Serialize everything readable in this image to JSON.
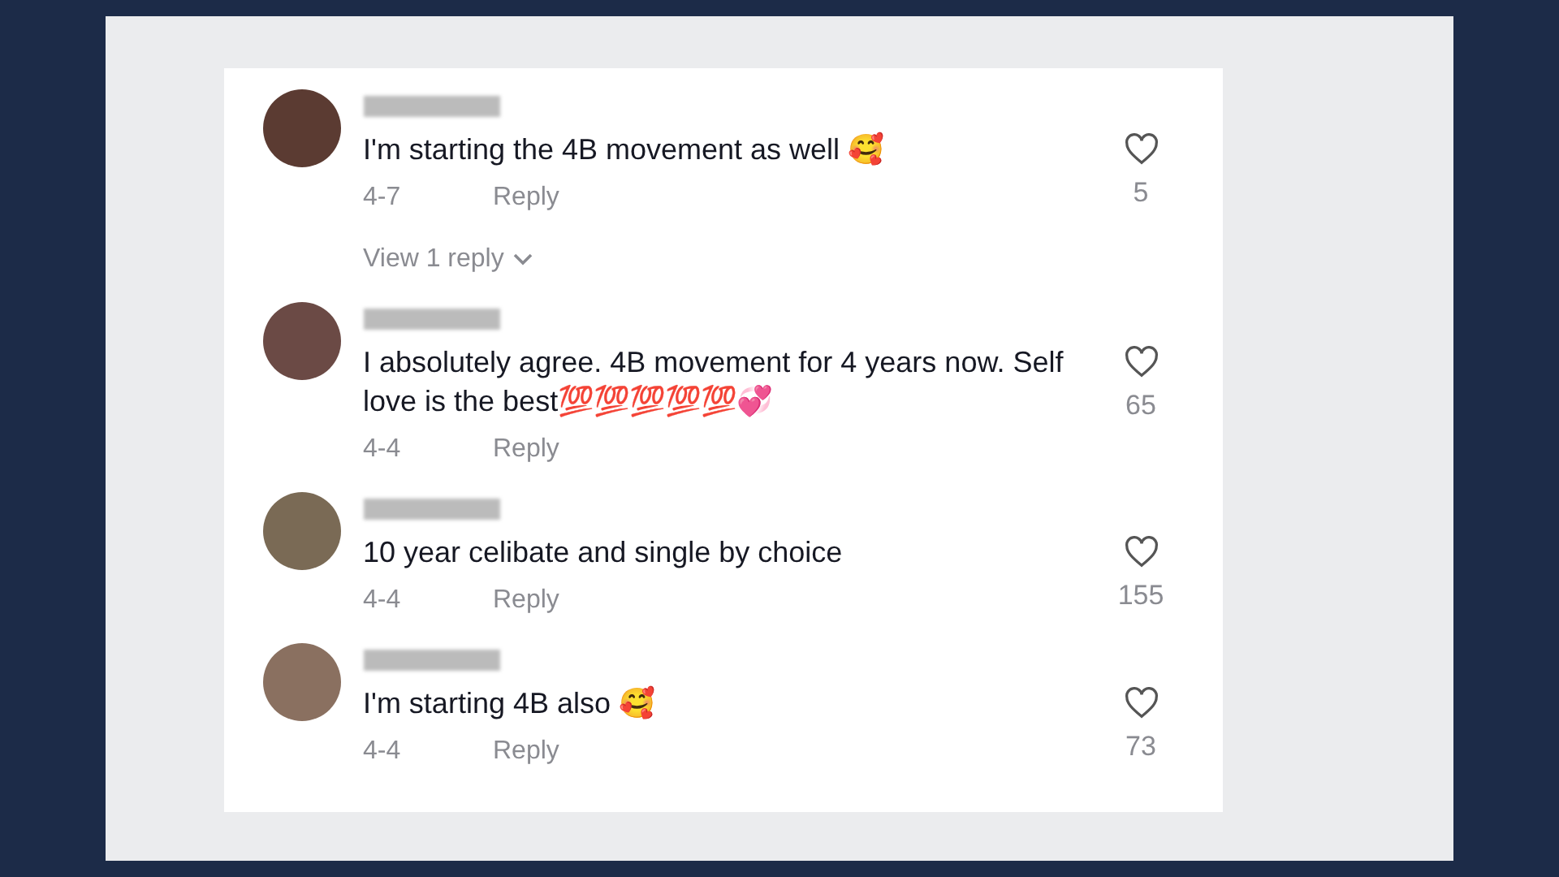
{
  "comments": [
    {
      "text": "I'm starting the 4B movement as well 🥰",
      "date": "4-7",
      "reply": "Reply",
      "likes": "5",
      "view_replies": "View 1 reply"
    },
    {
      "text": "I absolutely agree. 4B movement for 4 years now. Self love is the best💯💯💯💯💯💞",
      "date": "4-4",
      "reply": "Reply",
      "likes": "65"
    },
    {
      "text": "10 year celibate and single by choice",
      "date": "4-4",
      "reply": "Reply",
      "likes": "155"
    },
    {
      "text": "I'm starting 4B also 🥰",
      "date": "4-4",
      "reply": "Reply",
      "likes": "73"
    }
  ]
}
